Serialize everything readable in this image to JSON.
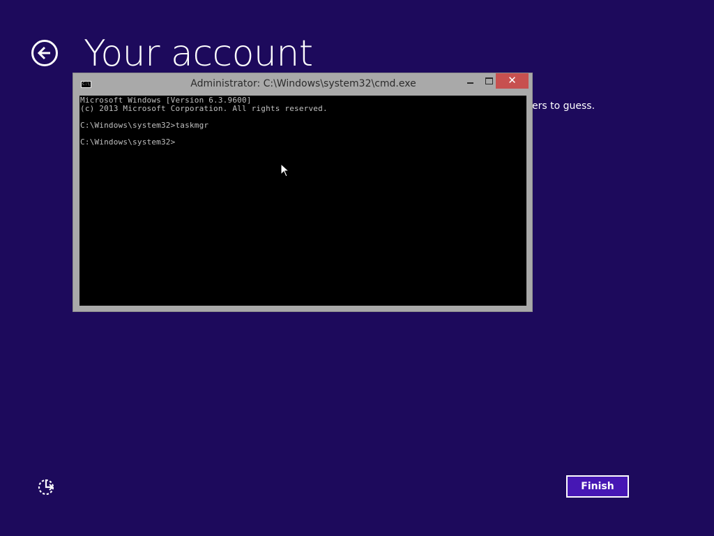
{
  "page": {
    "title": "Your account",
    "hint_visible_fragment": "ers to guess.",
    "back_icon": "back-arrow-icon",
    "ease_of_access_icon": "ease-of-access-icon"
  },
  "cmd_window": {
    "title": "Administrator: C:\\Windows\\system32\\cmd.exe",
    "app_icon_label": "C:\\",
    "close_glyph": "✕",
    "console_lines": [
      "Microsoft Windows [Version 6.3.9600]",
      "(c) 2013 Microsoft Corporation. All rights reserved.",
      "",
      "C:\\Windows\\system32>taskmgr",
      "",
      "C:\\Windows\\system32>"
    ]
  },
  "footer": {
    "finish_label": "Finish"
  },
  "colors": {
    "background": "#1d0a5c",
    "accent": "#4617b4",
    "close_button": "#c7504f",
    "console_bg": "#000000",
    "console_text": "#c0c0c0"
  }
}
